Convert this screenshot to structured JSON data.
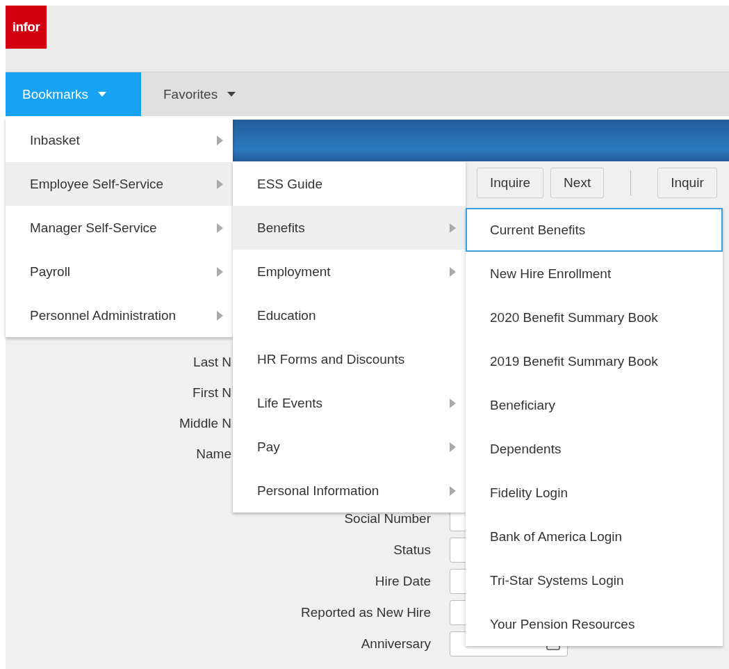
{
  "logo": {
    "text": "infor"
  },
  "nav_tabs": [
    {
      "label": "Bookmarks",
      "selected": true
    },
    {
      "label": "Favorites",
      "selected": false
    }
  ],
  "toolbar": {
    "buttons": [
      "Inquire",
      "Next"
    ],
    "edge_button": "Inquir"
  },
  "form": {
    "upper_labels": [
      "Last N",
      "First N",
      "Middle N",
      "Name"
    ],
    "lower_labels": [
      "Social Number",
      "Status",
      "Hire Date",
      "Reported as New Hire",
      "Anniversary"
    ]
  },
  "menus": [
    {
      "items": [
        {
          "label": "Inbasket",
          "selected": false,
          "submenu": true,
          "focused": false
        },
        {
          "label": "Employee Self-Service",
          "selected": true,
          "submenu": true,
          "focused": false
        },
        {
          "label": "Manager Self-Service",
          "selected": false,
          "submenu": true,
          "focused": false
        },
        {
          "label": "Payroll",
          "selected": false,
          "submenu": true,
          "focused": false
        },
        {
          "label": "Personnel Administration",
          "selected": false,
          "submenu": true,
          "focused": false
        }
      ]
    },
    {
      "items": [
        {
          "label": "ESS Guide",
          "selected": false,
          "submenu": false,
          "focused": false
        },
        {
          "label": "Benefits",
          "selected": true,
          "submenu": true,
          "focused": false
        },
        {
          "label": "Employment",
          "selected": false,
          "submenu": true,
          "focused": false
        },
        {
          "label": "Education",
          "selected": false,
          "submenu": false,
          "focused": false
        },
        {
          "label": "HR Forms and Discounts",
          "selected": false,
          "submenu": false,
          "focused": false
        },
        {
          "label": "Life Events",
          "selected": false,
          "submenu": true,
          "focused": false
        },
        {
          "label": "Pay",
          "selected": false,
          "submenu": true,
          "focused": false
        },
        {
          "label": "Personal Information",
          "selected": false,
          "submenu": true,
          "focused": false
        }
      ]
    },
    {
      "items": [
        {
          "label": "Current Benefits",
          "selected": false,
          "submenu": false,
          "focused": true
        },
        {
          "label": "New Hire Enrollment",
          "selected": false,
          "submenu": false,
          "focused": false
        },
        {
          "label": "2020 Benefit Summary Book",
          "selected": false,
          "submenu": false,
          "focused": false
        },
        {
          "label": "2019 Benefit Summary Book",
          "selected": false,
          "submenu": false,
          "focused": false
        },
        {
          "label": "Beneficiary",
          "selected": false,
          "submenu": false,
          "focused": false
        },
        {
          "label": "Dependents",
          "selected": false,
          "submenu": false,
          "focused": false
        },
        {
          "label": "Fidelity Login",
          "selected": false,
          "submenu": false,
          "focused": false
        },
        {
          "label": "Bank of America Login",
          "selected": false,
          "submenu": false,
          "focused": false
        },
        {
          "label": "Tri-Star Systems Login",
          "selected": false,
          "submenu": false,
          "focused": false
        },
        {
          "label": "Your Pension Resources",
          "selected": false,
          "submenu": false,
          "focused": false
        }
      ]
    }
  ]
}
